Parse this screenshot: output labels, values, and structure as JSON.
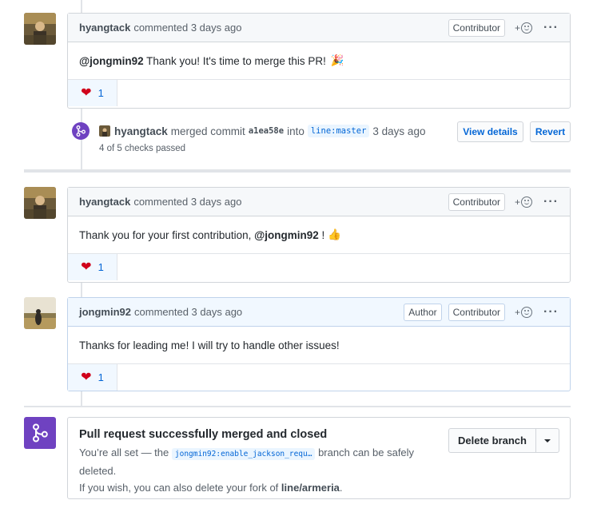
{
  "comments": [
    {
      "author": "hyangtack",
      "action": "commented 3 days ago",
      "labels": [
        "Contributor"
      ],
      "mention": "@jongmin92",
      "body": " Thank you! It's time to merge this PR! ",
      "emoji": "🎉",
      "reaction_count": "1"
    },
    {
      "author": "hyangtack",
      "action": "commented 3 days ago",
      "labels": [
        "Contributor"
      ],
      "body_before": "Thank you for your first contribution, ",
      "mention": "@jongmin92",
      "body_after": " ! ",
      "emoji": "👍",
      "reaction_count": "1"
    },
    {
      "author": "jongmin92",
      "action": "commented 3 days ago",
      "labels": [
        "Author",
        "Contributor"
      ],
      "body": "Thanks for leading me! I will try to handle other issues!",
      "reaction_count": "1"
    }
  ],
  "merge_event": {
    "user": "hyangtack",
    "verb": "merged commit",
    "commit": "a1ea58e",
    "into": "into",
    "branch": "line:master",
    "time": "3 days ago",
    "checks": "4 of 5 checks passed",
    "view_details": "View details",
    "revert": "Revert"
  },
  "merged_box": {
    "title": "Pull request successfully merged and closed",
    "desc_before": "You’re all set — the ",
    "branch": "jongmin92:enable_jackson_requ…",
    "desc_after": " branch can be safely deleted.",
    "fork_before": "If you wish, you can also delete your fork of ",
    "repo": "line/armeria",
    "fork_after": ".",
    "delete_label": "Delete branch"
  },
  "colors": {
    "merge_purple": "#6f42c1",
    "link_blue": "#0366d6",
    "heart_red": "#d0021b"
  },
  "icons": {
    "reaction": "smiley-icon",
    "more": "kebab-horizontal-icon",
    "merge": "git-merge-icon",
    "heart": "heart-emoji",
    "caret": "triangle-down-icon"
  }
}
